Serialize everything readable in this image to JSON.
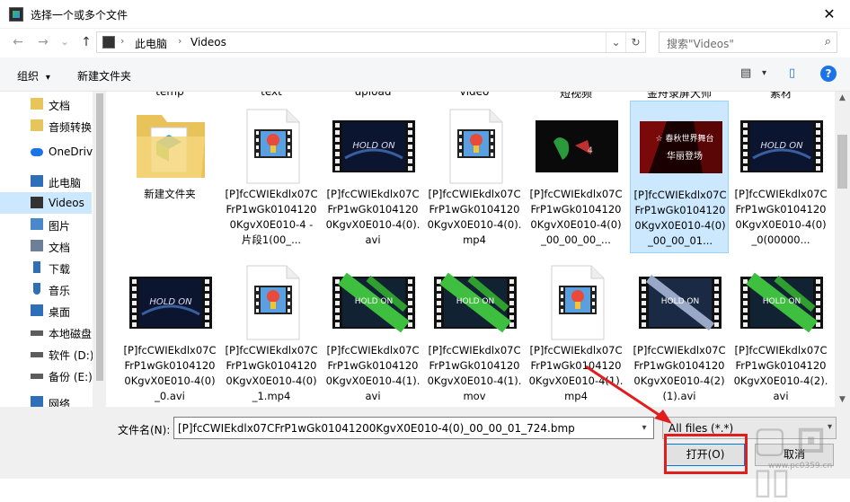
{
  "window": {
    "title": "选择一个或多个文件",
    "close": "✕"
  },
  "nav": {
    "back": "←",
    "forward": "→",
    "recent": "⌄",
    "up": "↑",
    "breadcrumb": [
      "此电脑",
      "Videos"
    ],
    "sep": "›",
    "dropdown": "⌄",
    "refresh": "↻",
    "search_placeholder": "搜索\"Videos\"",
    "search_icon": "⌕"
  },
  "toolbar": {
    "organize": "组织",
    "new_folder": "新建文件夹",
    "view_icon": "▤",
    "caret": "▾",
    "pane_icon": "▯",
    "help": "?"
  },
  "sidebar": {
    "items": [
      {
        "label": "文档",
        "icon": "folder-icon",
        "color": "#e8c55b"
      },
      {
        "label": "音频转换",
        "icon": "folder-icon",
        "color": "#e8c55b"
      },
      {
        "label": "OneDrive",
        "icon": "cloud-icon",
        "color": "#1a73e8"
      },
      {
        "label": "此电脑",
        "icon": "computer-icon",
        "color": "#2f6fb8"
      },
      {
        "label": "Videos",
        "icon": "video-icon",
        "color": "#333333"
      },
      {
        "label": "图片",
        "icon": "picture-icon",
        "color": "#4a88c7"
      },
      {
        "label": "文档",
        "icon": "document-icon",
        "color": "#6d7f99"
      },
      {
        "label": "下载",
        "icon": "download-icon",
        "color": "#2f6fb8"
      },
      {
        "label": "音乐",
        "icon": "music-icon",
        "color": "#2f6fb8"
      },
      {
        "label": "桌面",
        "icon": "desktop-icon",
        "color": "#2f6fb8"
      },
      {
        "label": "本地磁盘",
        "icon": "drive-icon",
        "color": "#5c5c5c"
      },
      {
        "label": "软件 (D:)",
        "icon": "drive-icon",
        "color": "#5c5c5c"
      },
      {
        "label": "备份 (E:)",
        "icon": "drive-icon",
        "color": "#5c5c5c"
      },
      {
        "label": "网络",
        "icon": "network-icon",
        "color": "#2f6fb8"
      }
    ]
  },
  "content": {
    "top_labels": [
      "temp",
      "text",
      "upload",
      "video",
      "短视频",
      "金舟录屏大师",
      "素材"
    ],
    "files": [
      {
        "name": "新建文件夹",
        "kind": "folder"
      },
      {
        "name": "[P]fcCWIEkdlx07CFrP1wGk01041200KgvX0E010-4 - 片段1(00_...",
        "kind": "doc-video"
      },
      {
        "name": "[P]fcCWIEkdlx07CFrP1wGk01041200KgvX0E010-4(0).avi",
        "kind": "film-dark"
      },
      {
        "name": "[P]fcCWIEkdlx07CFrP1wGk01041200KgvX0E010-4(0).mp4",
        "kind": "doc-video"
      },
      {
        "name": "[P]fcCWIEkdlx07CFrP1wGk01041200KgvX0E010-4(0)_00_00_00_...",
        "kind": "image-green"
      },
      {
        "name": "[P]fcCWIEkdlx07CFrP1wGk01041200KgvX0E010-4(0)_00_00_01...",
        "kind": "image-red",
        "selected": true
      },
      {
        "name": "[P]fcCWIEkdlx07CFrP1wGk01041200KgvX0E010-4(0)_0(00000...",
        "kind": "film-dark"
      },
      {
        "name": "[P]fcCWIEkdlx07CFrP1wGk01041200KgvX0E010-4(0)_0.avi",
        "kind": "film-dark"
      },
      {
        "name": "[P]fcCWIEkdlx07CFrP1wGk01041200KgvX0E010-4(0)_1.mp4",
        "kind": "doc-video"
      },
      {
        "name": "[P]fcCWIEkdlx07CFrP1wGk01041200KgvX0E010-4(1).avi",
        "kind": "film-green"
      },
      {
        "name": "[P]fcCWIEkdlx07CFrP1wGk01041200KgvX0E010-4(1).mov",
        "kind": "film-green"
      },
      {
        "name": "[P]fcCWIEkdlx07CFrP1wGk01041200KgvX0E010-4(1).mp4",
        "kind": "doc-video"
      },
      {
        "name": "[P]fcCWIEkdlx07CFrP1wGk01041200KgvX0E010-4(2)(1).avi",
        "kind": "film-blue"
      },
      {
        "name": "[P]fcCWIEkdlx07CFrP1wGk01041200KgvX0E010-4(2).avi",
        "kind": "film-green"
      }
    ]
  },
  "footer": {
    "filename_label": "文件名(N):",
    "filename_value": "[P]fcCWIEkdlx07CFrP1wGk01041200KgvX0E010-4(0)_00_00_01_724.bmp",
    "filter_value": "All files (*.*)",
    "open_button": "打开(O)",
    "cancel_button": "取消"
  },
  "colors": {
    "selection": "#cce8ff",
    "annotation": "#e01e1e"
  }
}
